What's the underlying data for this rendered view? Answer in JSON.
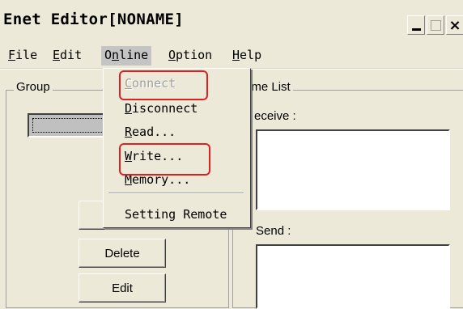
{
  "window": {
    "title": "Enet Editor[NONAME]",
    "minimize_icon": "minimize-icon",
    "maximize_icon": "maximize-icon",
    "close_icon": "close-icon",
    "close_glyph": "×"
  },
  "menubar": {
    "items": [
      {
        "label": "File",
        "mnemonic": "F"
      },
      {
        "label": "Edit",
        "mnemonic": "E"
      },
      {
        "label": "Online",
        "mnemonic": "n"
      },
      {
        "label": "Option",
        "mnemonic": "O"
      },
      {
        "label": "Help",
        "mnemonic": "H"
      }
    ],
    "active": "Online"
  },
  "online_menu": {
    "items": [
      {
        "label": "Connect",
        "enabled": false,
        "highlighted": true
      },
      {
        "label": "Disconnect",
        "enabled": true
      },
      {
        "label": "Read...",
        "enabled": true
      },
      {
        "label": "Write...",
        "enabled": true,
        "highlighted": true
      },
      {
        "label": "Memory...",
        "enabled": true
      },
      {
        "label": "Setting Remote",
        "enabled": true
      }
    ],
    "highlight_color": "#e02020"
  },
  "group": {
    "label": "Group",
    "buttons": {
      "delete": "Delete",
      "edit": "Edit"
    }
  },
  "frame_list": {
    "label_visible": "ame List",
    "receive_label_visible": "eceive :",
    "send_label": "Send :"
  },
  "colors": {
    "window_bg": "#ece9d8",
    "active_menu_bg": "#c4c4c4",
    "disabled_text": "#a0a0a0"
  }
}
